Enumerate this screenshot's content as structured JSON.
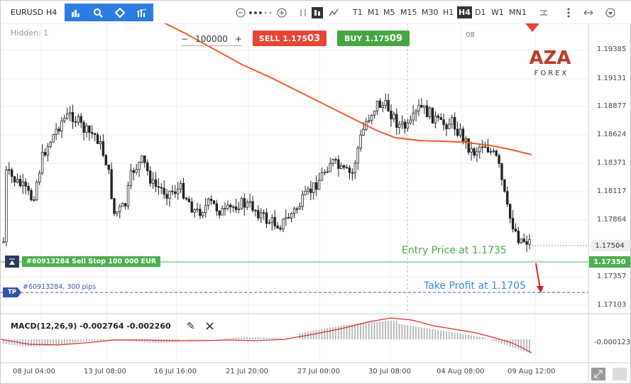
{
  "toolbar": {
    "symbol": "EURUSD",
    "period": "H4",
    "timeframes": [
      "T1",
      "M1",
      "M5",
      "M15",
      "M30",
      "H1",
      "H4",
      "D1",
      "W1",
      "MN1"
    ],
    "active_timeframe": "H4"
  },
  "order_panel": {
    "hidden_label": "Hidden: 1",
    "quantity": "100000",
    "minus": "−",
    "plus": "+",
    "sell_label": "SELL 1.175",
    "sell_big": "03",
    "buy_label": "BUY 1.175",
    "buy_big": "09",
    "hour_marker": "08"
  },
  "logo": {
    "text": "AZA",
    "sub": "FOREX",
    "color": "#c0392b"
  },
  "price_axis": {
    "ticks": [
      "1.19385",
      "1.19131",
      "1.18877",
      "1.18624",
      "1.18371",
      "1.18117",
      "1.17864",
      "1.17504",
      "1.17350",
      "1.17357",
      "1.17103",
      "-0.000123"
    ],
    "current_price": "1.17504",
    "order_price": "1.17350"
  },
  "time_axis": {
    "ticks": [
      "08 Jul 04:00",
      "13 Jul 08:00",
      "16 Jul 16:00",
      "21 Jul 20:00",
      "27 Jul 00:00",
      "30 Jul 08:00",
      "04 Aug 08:00",
      "09 Aug 12:00"
    ]
  },
  "order": {
    "label": "#60913284 Sell Stop 100 000 EUR",
    "tp_badge": "TP",
    "tp_text": "#60913284, 300 pips",
    "entry_note": "Entry Price at 1.1735",
    "tp_note": "Take Profit at 1.1705"
  },
  "macd": {
    "label": "MACD(12,26,9) -0.002764 -0.002260"
  },
  "colors": {
    "ma_line": "#f05a28",
    "sell": "#e94434",
    "buy": "#45a73f",
    "order_line": "#4caf50",
    "tp_line": "#3b5ca8",
    "macd_signal": "#d32f2f"
  },
  "icons": [
    "bar-chart-icon",
    "indicator-icon",
    "drawing-icon",
    "studies-icon",
    "zoom-out-icon",
    "zoom-in-icon",
    "candles-icon",
    "line-icon",
    "settings-icon",
    "more-icon",
    "menu-icon"
  ]
}
